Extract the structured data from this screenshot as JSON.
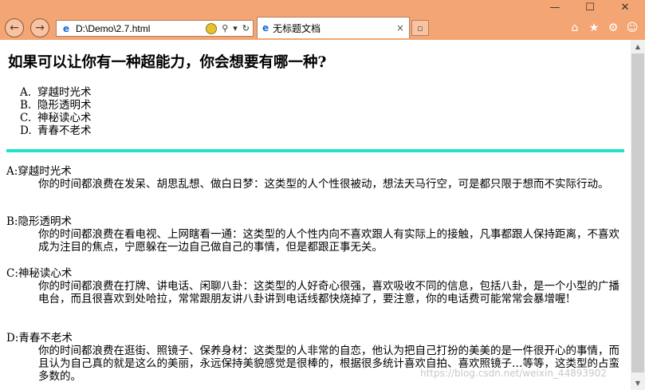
{
  "window": {
    "minimize": "—",
    "maximize": "☐",
    "close": "✕"
  },
  "toolbar": {
    "back": "←",
    "forward": "→",
    "address": "D:\\Demo\\2.7.html",
    "tab_title": "无标题文档",
    "tab_close": "×"
  },
  "page": {
    "question": "如果可以让你有一种超能力，你会想要有哪一种?",
    "options": [
      {
        "letter": "A.",
        "text": "穿越时光术"
      },
      {
        "letter": "B.",
        "text": "隐形透明术"
      },
      {
        "letter": "C.",
        "text": "神秘读心术"
      },
      {
        "letter": "D.",
        "text": "青春不老术"
      }
    ],
    "answers": [
      {
        "head": "A:穿越时光术",
        "body": "你的时间都浪费在发呆、胡思乱想、做白日梦：这类型的人个性很被动，想法天马行空，可是都只限于想而不实际行动。"
      },
      {
        "head": "B:隐形透明术",
        "body": "你的时间都浪费在看电视、上网瞎看一通：这类型的人个性内向不喜欢跟人有实际上的接触，凡事都跟人保持距离，不喜欢成为注目的焦点，宁愿躲在一边自己做自己的事情，但是都跟正事无关。"
      },
      {
        "head": "C:神秘读心术",
        "body": "你的时间都浪费在打牌、讲电话、闲聊八卦：这类型的人好奇心很强，喜欢吸收不同的信息，包括八卦，是一个小型的广播电台，而且很喜欢到处哈拉，常常跟朋友讲八卦讲到电话线都快烧掉了，要注意，你的电话费可能常常会暴增喔!"
      },
      {
        "head": "D:青春不老术",
        "body": "你的时间都浪费在逛街、照镜子、保养身材：这类型的人非常的自恋，他认为把自己打扮的美美的是一件很开心的事情，而且认为自己真的就是这么的美丽，永远保持美貌感觉是很棒的，根据很多统计喜欢自拍、喜欢照镜子…等等，这类型的占蛮多数的。"
      }
    ]
  },
  "watermark": "https://blog.csdn.net/weixin_44893902"
}
